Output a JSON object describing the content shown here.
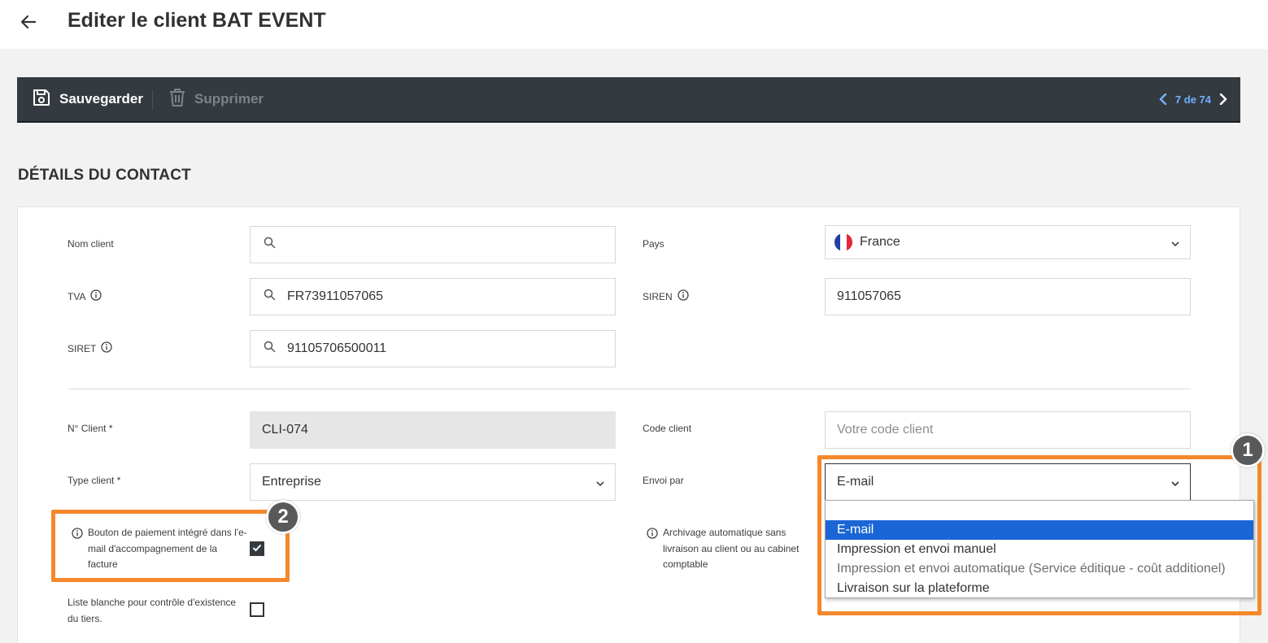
{
  "header": {
    "title": "Editer le client BAT EVENT"
  },
  "toolbar": {
    "save_label": "Sauvegarder",
    "delete_label": "Supprimer",
    "pager_label": "7 de 74"
  },
  "section": {
    "title": "DÉTAILS DU CONTACT"
  },
  "form": {
    "nom_client": {
      "label": "Nom client",
      "value": ""
    },
    "pays": {
      "label": "Pays",
      "value": "France"
    },
    "tva": {
      "label": "TVA",
      "value": "FR73911057065"
    },
    "siren": {
      "label": "SIREN",
      "value": "911057065"
    },
    "siret": {
      "label": "SIRET",
      "value": "91105706500011"
    },
    "n_client": {
      "label": "N° Client *",
      "value": "CLI-074"
    },
    "code_client": {
      "label": "Code client",
      "placeholder": "Votre code client"
    },
    "type_client": {
      "label": "Type client *",
      "value": "Entreprise"
    },
    "envoi_par": {
      "label": "Envoi par",
      "value": "E-mail",
      "options": [
        "E-mail",
        "Impression et envoi manuel",
        "Impression et envoi automatique (Service éditique - coût additionel)",
        "Livraison sur la plateforme"
      ]
    },
    "bouton_paiement": {
      "label": "Bouton de paiement intégré dans l'e-mail d'accompagnement de la facture",
      "checked": true
    },
    "archivage": {
      "label": "Archivage automatique sans livraison au client ou au cabinet comptable"
    },
    "liste_blanche": {
      "label": "Liste blanche pour contrôle d'existence du tiers.",
      "checked": false
    }
  },
  "annotations": {
    "badge_1": "1",
    "badge_2": "2",
    "color": "#f5882b"
  },
  "colors": {
    "toolbar_bg": "#343a40",
    "pager_link": "#6fb3ff",
    "selected_option": "#1a66d6"
  }
}
